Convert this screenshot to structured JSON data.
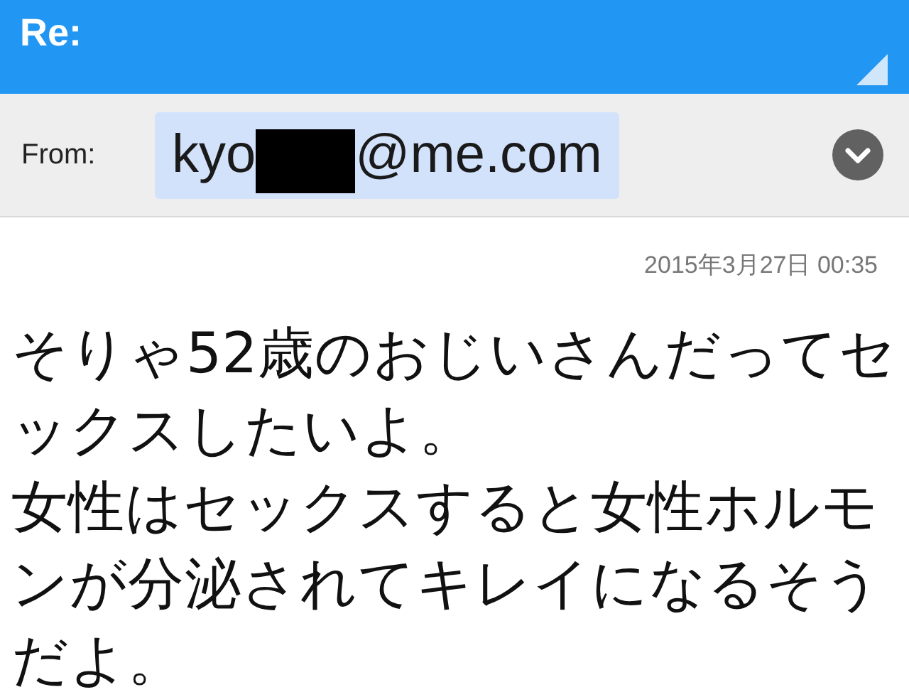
{
  "header": {
    "title": "Re:"
  },
  "from": {
    "label": "From:",
    "address_start": "kyo",
    "address_end": "@me.com",
    "redacted": true
  },
  "date": "2015年3月27日 00:35",
  "body_lines": [
    "そりゃ52歳のおじいさんだってセ",
    "ックスしたいよ。",
    "女性はセックスすると女性ホルモ",
    "ンが分泌されてキレイになるそう",
    "だよ。"
  ]
}
